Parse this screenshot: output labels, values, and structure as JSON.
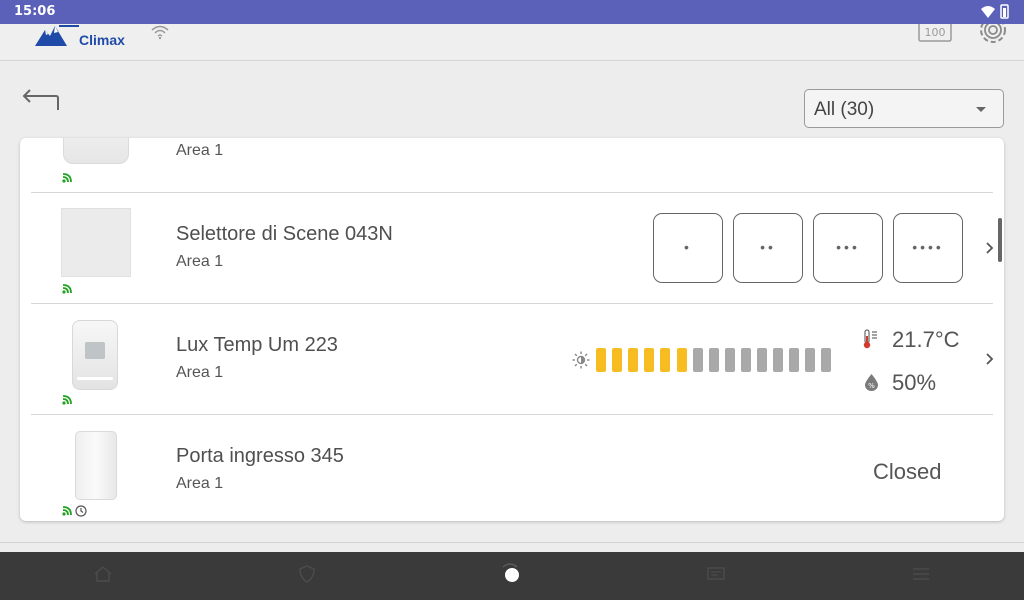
{
  "status_bar": {
    "time": "15:06"
  },
  "header": {
    "brand": "Climax",
    "battery_label": "100"
  },
  "filter": {
    "selected": "All (30)"
  },
  "devices": [
    {
      "name": "",
      "area": "Area 1"
    },
    {
      "name": "Selettore di Scene 043N",
      "area": "Area 1",
      "scene_buttons": [
        "•",
        "••",
        "•••",
        "••••"
      ]
    },
    {
      "name": "Lux Temp Um 223",
      "area": "Area 1",
      "lux_level": 0.4,
      "temperature": "21.7°C",
      "humidity": "50%"
    },
    {
      "name": "Porta ingresso 345",
      "area": "Area 1",
      "status": "Closed"
    }
  ],
  "colors": {
    "status_bar": "#5b60b8",
    "brand": "#1f4aa8",
    "lux_on": "#f7bd23",
    "lux_off": "#a9a9a9",
    "signal": "#21a321",
    "nav_bar": "#3a3a3a"
  },
  "icons": [
    "wifi-icon",
    "battery-icon",
    "back-arrow-icon",
    "settings-icon",
    "signal-icon",
    "clock-icon",
    "sun-icon",
    "thermometer-icon",
    "humidity-icon",
    "chevron-right-icon"
  ]
}
